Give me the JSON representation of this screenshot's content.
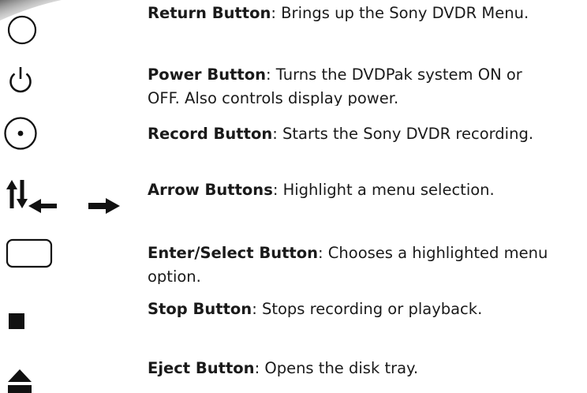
{
  "legend": [
    {
      "icon": "return-circle-icon",
      "term": "Return Button",
      "sep": ":",
      "text": " Brings up the Sony DVDR Menu."
    },
    {
      "icon": "power-icon",
      "term": "Power Button",
      "sep": ":",
      "text": " Turns the DVDPak system ON or",
      "text2": "OFF. Also controls display power."
    },
    {
      "icon": "record-dot-circle-icon",
      "term": "Record Button",
      "sep": ":",
      "text": " Starts the Sony DVDR recording."
    },
    {
      "icon": "arrows-icon",
      "term": "Arrow Buttons",
      "sep": ":",
      "text": " Highlight a menu selection."
    },
    {
      "icon": "rounded-rectangle-icon",
      "term": "Enter/Select Button",
      "sep": ":",
      "text": " Chooses a highlighted menu",
      "text2": "option."
    },
    {
      "icon": "stop-square-icon",
      "term": "Stop Button",
      "sep": ":",
      "text": " Stops recording or playback."
    },
    {
      "icon": "eject-icon",
      "term": "Eject Button",
      "sep": ":",
      "text": " Opens the disk tray."
    }
  ],
  "colors": {
    "text": "#1a1a1a",
    "icon": "#111111",
    "curl": "#9a9a9a"
  }
}
